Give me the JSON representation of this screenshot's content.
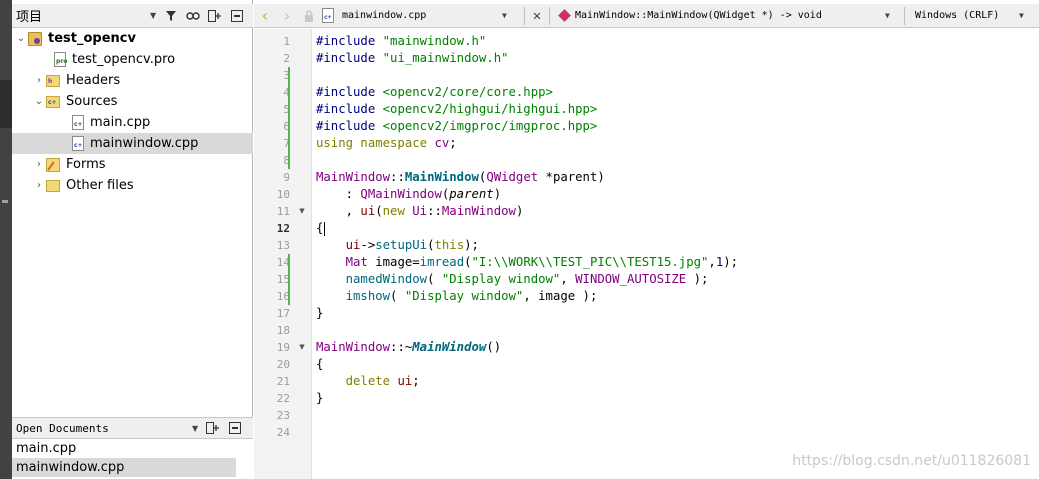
{
  "project_pane": {
    "title": "项目",
    "tree": [
      {
        "id": "project",
        "label": "test_opencv",
        "level": 0,
        "expanded": true,
        "icon": "project-icon",
        "bold": true
      },
      {
        "id": "pro",
        "label": "test_opencv.pro",
        "level": 1,
        "icon": "pro-file-icon"
      },
      {
        "id": "headers",
        "label": "Headers",
        "level": 1,
        "expanded": false,
        "icon": "headers-folder-icon"
      },
      {
        "id": "sources",
        "label": "Sources",
        "level": 1,
        "expanded": true,
        "icon": "sources-folder-icon"
      },
      {
        "id": "main",
        "label": "main.cpp",
        "level": 2,
        "icon": "cpp-file-icon"
      },
      {
        "id": "mainwindow",
        "label": "mainwindow.cpp",
        "level": 2,
        "icon": "cpp-file-icon",
        "selected": true
      },
      {
        "id": "forms",
        "label": "Forms",
        "level": 1,
        "expanded": false,
        "icon": "forms-folder-icon"
      },
      {
        "id": "other",
        "label": "Other files",
        "level": 1,
        "expanded": false,
        "icon": "other-folder-icon"
      }
    ]
  },
  "open_documents": {
    "title": "Open Documents",
    "items": [
      {
        "label": "main.cpp",
        "selected": false
      },
      {
        "label": "mainwindow.cpp",
        "selected": true
      }
    ]
  },
  "editor": {
    "file_name": "mainwindow.cpp",
    "symbol": "MainWindow::MainWindow(QWidget *) -> void",
    "encoding": "Windows (CRLF)",
    "current_line": 12,
    "modified_lines": [
      3,
      4,
      5,
      6,
      7,
      8,
      14,
      15,
      16
    ],
    "fold_lines": [
      11,
      19
    ],
    "lines": [
      [
        {
          "t": "#include ",
          "c": "#000080"
        },
        {
          "t": "\"mainwindow.h\"",
          "c": "#008000"
        }
      ],
      [
        {
          "t": "#include ",
          "c": "#000080"
        },
        {
          "t": "\"ui_mainwindow.h\"",
          "c": "#008000"
        }
      ],
      [],
      [
        {
          "t": "#include ",
          "c": "#000080"
        },
        {
          "t": "<opencv2/core/core.hpp>",
          "c": "#008000"
        }
      ],
      [
        {
          "t": "#include ",
          "c": "#000080"
        },
        {
          "t": "<opencv2/highgui/highgui.hpp>",
          "c": "#008000"
        }
      ],
      [
        {
          "t": "#include ",
          "c": "#000080"
        },
        {
          "t": "<opencv2/imgproc/imgproc.hpp>",
          "c": "#008000"
        }
      ],
      [
        {
          "t": "using namespace ",
          "c": "#808000"
        },
        {
          "t": "cv",
          "c": "#800080"
        },
        {
          "t": ";",
          "c": "#000000"
        }
      ],
      [],
      [
        {
          "t": "MainWindow",
          "c": "#800080"
        },
        {
          "t": "::",
          "c": "#000000"
        },
        {
          "t": "MainWindow",
          "c": "#00677c",
          "b": true
        },
        {
          "t": "(",
          "c": "#000000"
        },
        {
          "t": "QWidget",
          "c": "#800080"
        },
        {
          "t": " *parent)",
          "c": "#000000"
        }
      ],
      [
        {
          "t": "    : ",
          "c": "#000000"
        },
        {
          "t": "QMainWindow",
          "c": "#800080"
        },
        {
          "t": "(",
          "c": "#000000"
        },
        {
          "t": "parent",
          "c": "#000000",
          "i": true
        },
        {
          "t": ")",
          "c": "#000000"
        }
      ],
      [
        {
          "t": "    , ",
          "c": "#000000"
        },
        {
          "t": "ui",
          "c": "#800000"
        },
        {
          "t": "(",
          "c": "#000000"
        },
        {
          "t": "new ",
          "c": "#808000"
        },
        {
          "t": "Ui",
          "c": "#800080"
        },
        {
          "t": "::",
          "c": "#000000"
        },
        {
          "t": "MainWindow",
          "c": "#800080"
        },
        {
          "t": ")",
          "c": "#000000"
        }
      ],
      [
        {
          "t": "{",
          "c": "#000000"
        }
      ],
      [
        {
          "t": "    ",
          "c": "#000000"
        },
        {
          "t": "ui",
          "c": "#800000"
        },
        {
          "t": "->",
          "c": "#000000"
        },
        {
          "t": "setupUi",
          "c": "#00677c"
        },
        {
          "t": "(",
          "c": "#000000"
        },
        {
          "t": "this",
          "c": "#808000"
        },
        {
          "t": ");",
          "c": "#000000"
        }
      ],
      [
        {
          "t": "    ",
          "c": "#000000"
        },
        {
          "t": "Mat",
          "c": "#800080"
        },
        {
          "t": " image=",
          "c": "#000000"
        },
        {
          "t": "imread",
          "c": "#00677c"
        },
        {
          "t": "(",
          "c": "#000000"
        },
        {
          "t": "\"I:\\\\WORK\\\\TEST_PIC\\\\TEST15.jpg\"",
          "c": "#008000"
        },
        {
          "t": ",",
          "c": "#000000"
        },
        {
          "t": "1",
          "c": "#000080"
        },
        {
          "t": ");",
          "c": "#000000"
        }
      ],
      [
        {
          "t": "    ",
          "c": "#000000"
        },
        {
          "t": "namedWindow",
          "c": "#00677c"
        },
        {
          "t": "( ",
          "c": "#000000"
        },
        {
          "t": "\"Display window\"",
          "c": "#008000"
        },
        {
          "t": ", ",
          "c": "#000000"
        },
        {
          "t": "WINDOW_AUTOSIZE",
          "c": "#800080"
        },
        {
          "t": " );",
          "c": "#000000"
        }
      ],
      [
        {
          "t": "    ",
          "c": "#000000"
        },
        {
          "t": "imshow",
          "c": "#00677c"
        },
        {
          "t": "( ",
          "c": "#000000"
        },
        {
          "t": "\"Display window\"",
          "c": "#008000"
        },
        {
          "t": ", image );",
          "c": "#000000"
        }
      ],
      [
        {
          "t": "}",
          "c": "#000000"
        }
      ],
      [],
      [
        {
          "t": "MainWindow",
          "c": "#800080"
        },
        {
          "t": "::~",
          "c": "#000000"
        },
        {
          "t": "MainWindow",
          "c": "#00677c",
          "b": true,
          "i": true
        },
        {
          "t": "()",
          "c": "#000000"
        }
      ],
      [
        {
          "t": "{",
          "c": "#000000"
        }
      ],
      [
        {
          "t": "    ",
          "c": "#000000"
        },
        {
          "t": "delete ",
          "c": "#808000"
        },
        {
          "t": "ui",
          "c": "#800000"
        },
        {
          "t": ";",
          "c": "#000000"
        }
      ],
      [
        {
          "t": "}",
          "c": "#000000"
        }
      ],
      [],
      []
    ]
  },
  "watermark": "https://blog.csdn.net/u011826081"
}
